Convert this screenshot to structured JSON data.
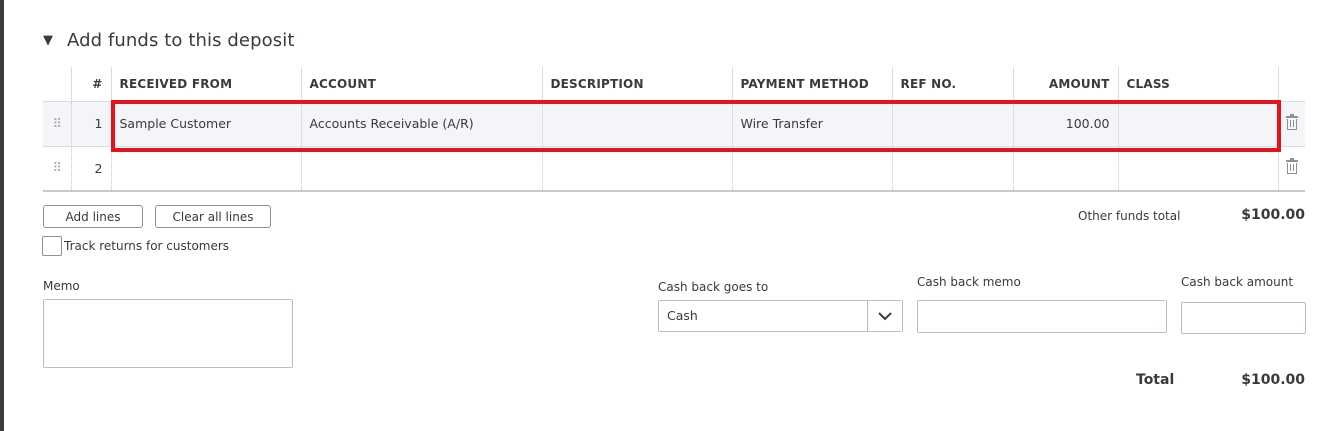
{
  "section": {
    "caret_icon": "triangle-down-icon",
    "title": "Add funds to this deposit"
  },
  "table": {
    "columns": {
      "num": "#",
      "received_from": "RECEIVED FROM",
      "account": "ACCOUNT",
      "description": "DESCRIPTION",
      "payment_method": "PAYMENT METHOD",
      "ref_no": "REF NO.",
      "amount": "AMOUNT",
      "class": "CLASS"
    },
    "rows": [
      {
        "num": "1",
        "received_from": "Sample Customer",
        "account": "Accounts Receivable (A/R)",
        "description": "",
        "payment_method": "Wire Transfer",
        "ref_no": "",
        "amount": "100.00",
        "class": ""
      },
      {
        "num": "2",
        "received_from": "",
        "account": "",
        "description": "",
        "payment_method": "",
        "ref_no": "",
        "amount": "",
        "class": ""
      }
    ]
  },
  "actions": {
    "add_lines": "Add lines",
    "clear_all_lines": "Clear all lines"
  },
  "track_returns": {
    "label": "Track returns for customers",
    "checked": false
  },
  "totals": {
    "other_funds_label": "Other funds total",
    "other_funds_value": "$100.00",
    "total_label": "Total",
    "total_value": "$100.00"
  },
  "memo": {
    "label": "Memo",
    "value": ""
  },
  "cash_back": {
    "goes_to_label": "Cash back goes to",
    "goes_to_value": "Cash",
    "memo_label": "Cash back memo",
    "memo_value": "",
    "amount_label": "Cash back amount",
    "amount_value": ""
  },
  "colors": {
    "highlight": "#e3141c",
    "text": "#393a3d",
    "row_selected_bg": "#f4f5f8"
  }
}
